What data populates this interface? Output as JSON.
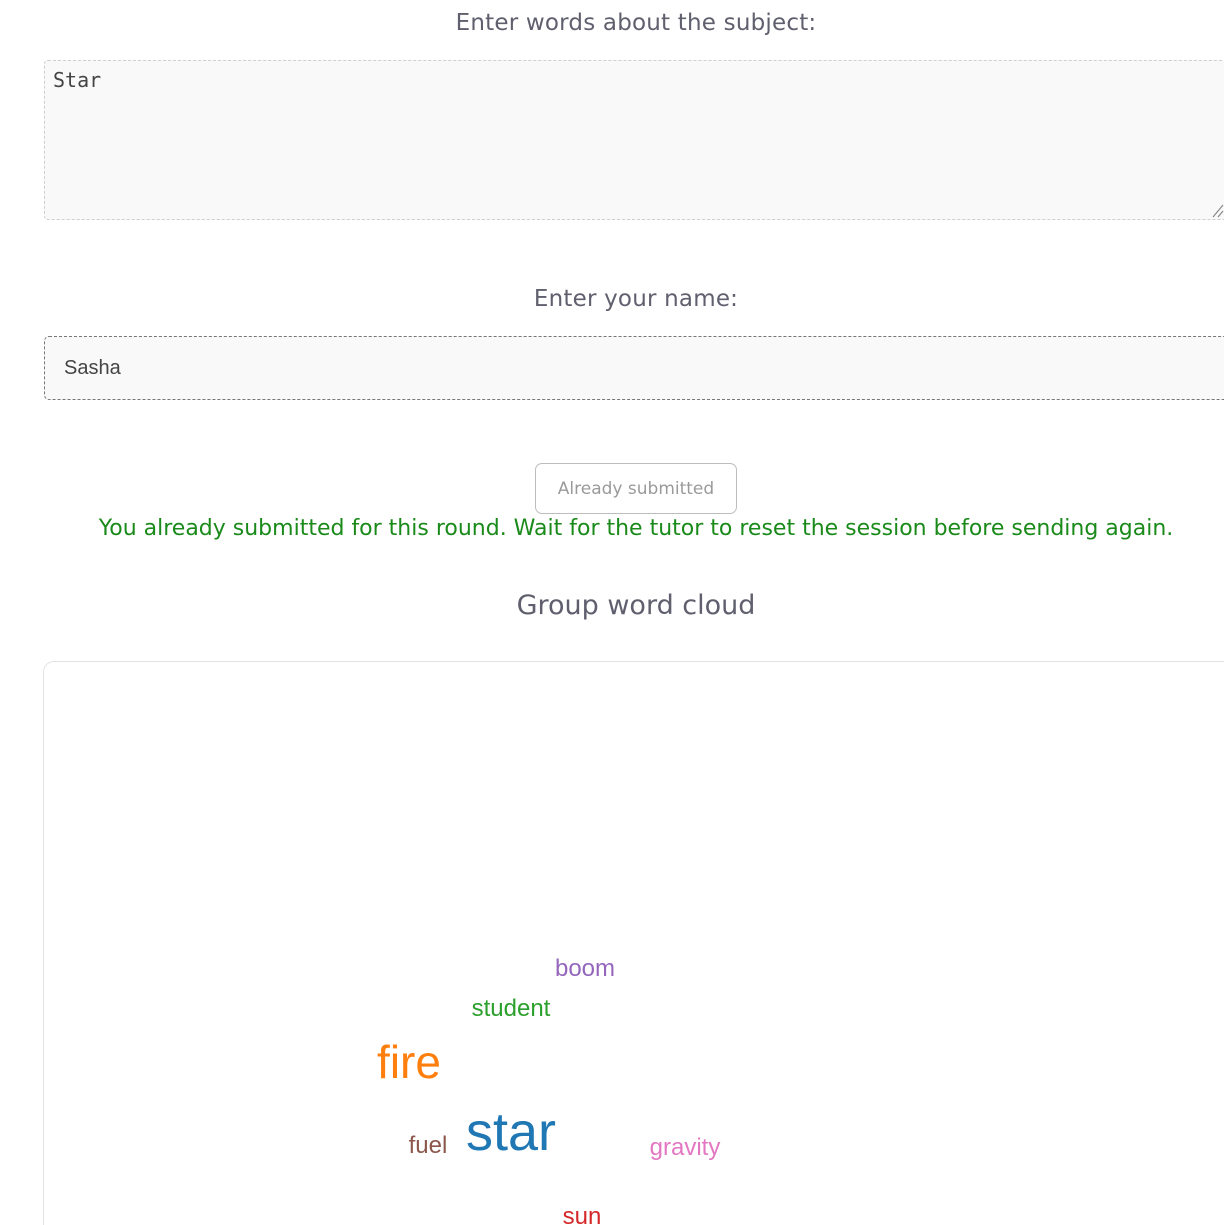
{
  "words_section": {
    "label": "Enter words about the subject:",
    "value": "Star"
  },
  "name_section": {
    "label": "Enter your name:",
    "value": "Sasha"
  },
  "submit_button": {
    "label": "Already submitted"
  },
  "status": {
    "message": "You already submitted for this round. Wait for the tutor to reset the session before sending again.",
    "color": "#1a8a1a"
  },
  "cloud": {
    "title": "Group word cloud",
    "words": [
      {
        "text": "boom",
        "color": "#9467bd"
      },
      {
        "text": "student",
        "color": "#2ca02c"
      },
      {
        "text": "fire",
        "color": "#ff7f0e"
      },
      {
        "text": "fuel",
        "color": "#8c564b"
      },
      {
        "text": "star",
        "color": "#1f77b4"
      },
      {
        "text": "gravity",
        "color": "#e377c2"
      },
      {
        "text": "sun",
        "color": "#d62728"
      }
    ]
  }
}
